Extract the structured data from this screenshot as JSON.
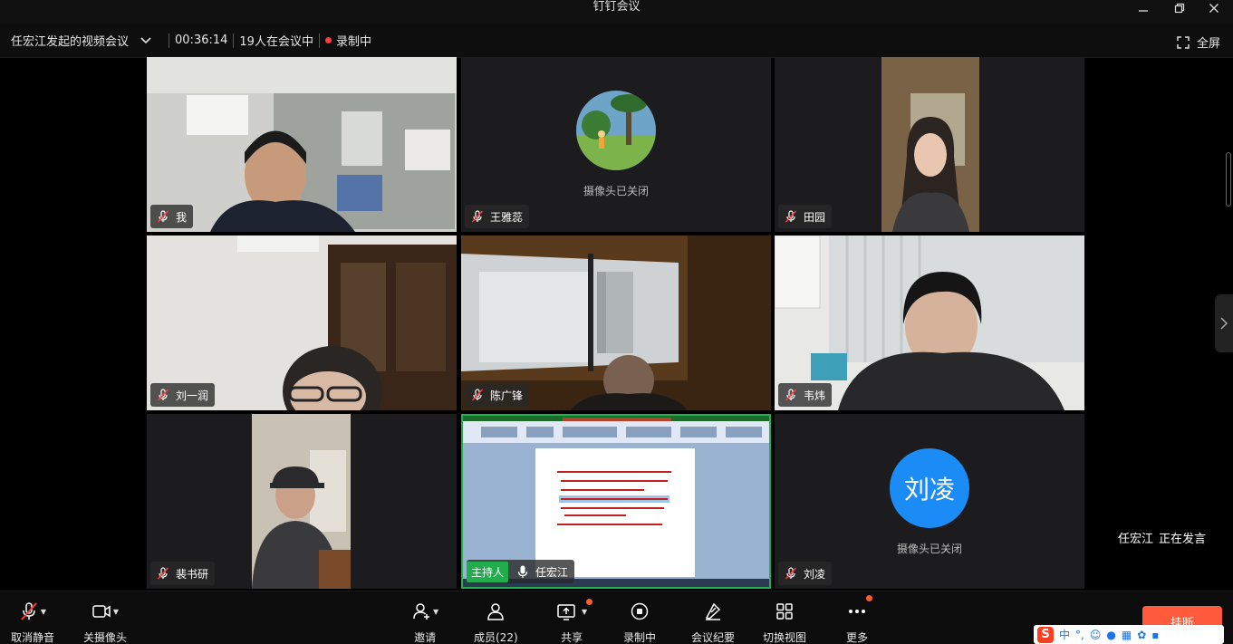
{
  "window": {
    "title": "钉钉会议"
  },
  "infobar": {
    "meeting_title": "任宏江发起的视频会议",
    "duration": "00:36:14",
    "participants_in_meeting": "19人在会议中",
    "recording_status": "录制中",
    "fullscreen_label": "全屏"
  },
  "tiles": [
    {
      "name": "我",
      "mic": "off",
      "camera": "on"
    },
    {
      "name": "王雅蕊",
      "mic": "off",
      "camera": "off",
      "camera_off_text": "摄像头已关闭"
    },
    {
      "name": "田园",
      "mic": "off",
      "camera": "on"
    },
    {
      "name": "刘一润",
      "mic": "off",
      "camera": "on"
    },
    {
      "name": "陈广锋",
      "mic": "off",
      "camera": "on"
    },
    {
      "name": "韦炜",
      "mic": "off",
      "camera": "on"
    },
    {
      "name": "裴书研",
      "mic": "off",
      "camera": "on"
    },
    {
      "name": "任宏江",
      "mic": "on",
      "camera": "screen-share",
      "host_badge": "主持人"
    },
    {
      "name": "刘凌",
      "mic": "off",
      "camera": "off",
      "camera_off_text": "摄像头已关闭",
      "avatar_text": "刘凌",
      "avatar_color": "#1b8cf5"
    }
  ],
  "speaking": {
    "name": "任宏江",
    "status": "正在发言"
  },
  "toolbar": {
    "mute": "取消静音",
    "camera": "关摄像头",
    "invite": "邀请",
    "members": "成员(22)",
    "share": "共享",
    "record": "录制中",
    "minutes": "会议纪要",
    "switch_view": "切换视图",
    "more": "更多",
    "hangup": "挂断"
  },
  "ime": {
    "mode": "中"
  },
  "colors": {
    "host_green": "#1fae4b",
    "active_border": "#1fb24e",
    "hangup": "#ff5a3c",
    "record_dot": "#ff3b3b",
    "avatar_blue": "#1b8cf5"
  }
}
